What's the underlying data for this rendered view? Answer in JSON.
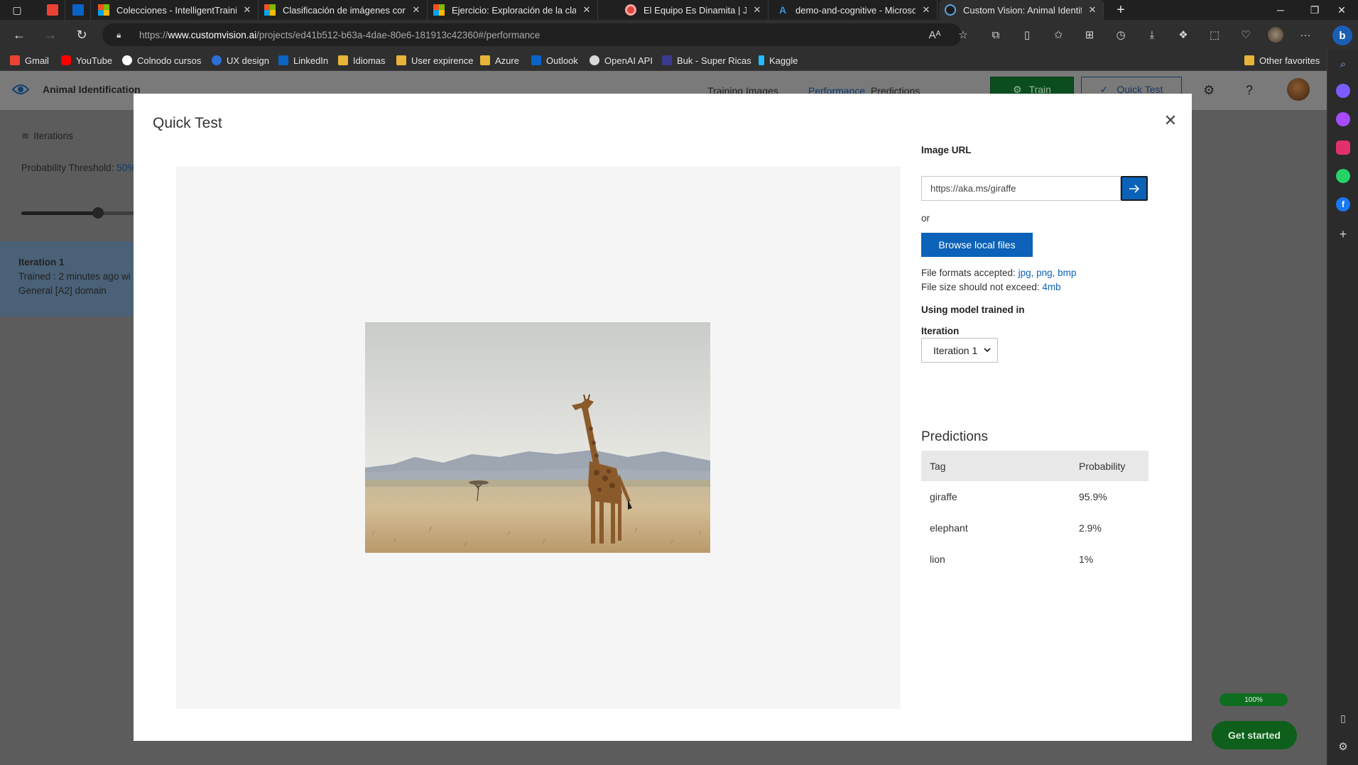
{
  "browser": {
    "tabs": [
      {
        "label": "Colecciones - IntelligentTraining"
      },
      {
        "label": "Clasificación de imágenes con el"
      },
      {
        "label": "Ejercicio: Exploración de la clasifi"
      },
      {
        "label": "El Equipo Es Dinamita | Jitsi"
      },
      {
        "label": "demo-and-cognitive - Microsoft"
      },
      {
        "label": "Custom Vision: Animal Identificati"
      }
    ],
    "url": {
      "protocol": "https://",
      "host": "www.customvision.ai",
      "path": "/projects/ed41b512-b63a-4dae-80e6-181913c42360#/performance"
    },
    "bookmarks": [
      "Gmail",
      "YouTube",
      "Colnodo cursos",
      "UX design",
      "LinkedIn",
      "Idiomas",
      "User expirence",
      "Azure",
      "Outlook",
      "OpenAI API",
      "Buk - Super Ricas",
      "Kaggle"
    ],
    "other_favorites": "Other favorites"
  },
  "app": {
    "title": "Animal Identification",
    "nav": [
      "Training Images",
      "Performance",
      "Predictions"
    ],
    "train_label": "Train",
    "quick_test_label": "Quick Test",
    "iterations_label": "Iterations",
    "threshold_label": "Probability Threshold:",
    "threshold_value": "50%",
    "iteration_card": {
      "name": "Iteration 1",
      "trained": "Trained : 2 minutes ago wi",
      "domain": "General [A2] domain"
    },
    "progress_label": "100%",
    "get_started": "Get started"
  },
  "modal": {
    "title": "Quick Test",
    "image_url_label": "Image URL",
    "image_url_value": "https://aka.ms/giraffe",
    "or_label": "or",
    "browse_label": "Browse local files",
    "formats_label": "File formats accepted:",
    "formats_value": "jpg, png, bmp",
    "size_label": "File size should not exceed:",
    "size_value": "4mb",
    "model_label": "Using model trained in",
    "iteration_label": "Iteration",
    "iteration_selected": "Iteration 1",
    "predictions_title": "Predictions",
    "table_headers": {
      "tag": "Tag",
      "probability": "Probability"
    },
    "predictions": [
      {
        "tag": "giraffe",
        "probability": "95.9%"
      },
      {
        "tag": "elephant",
        "probability": "2.9%"
      },
      {
        "tag": "lion",
        "probability": "1%"
      }
    ]
  },
  "colors": {
    "accent": "#0b62b8",
    "train_green": "#0b4d1e",
    "get_started_green": "#0e5f1c"
  }
}
